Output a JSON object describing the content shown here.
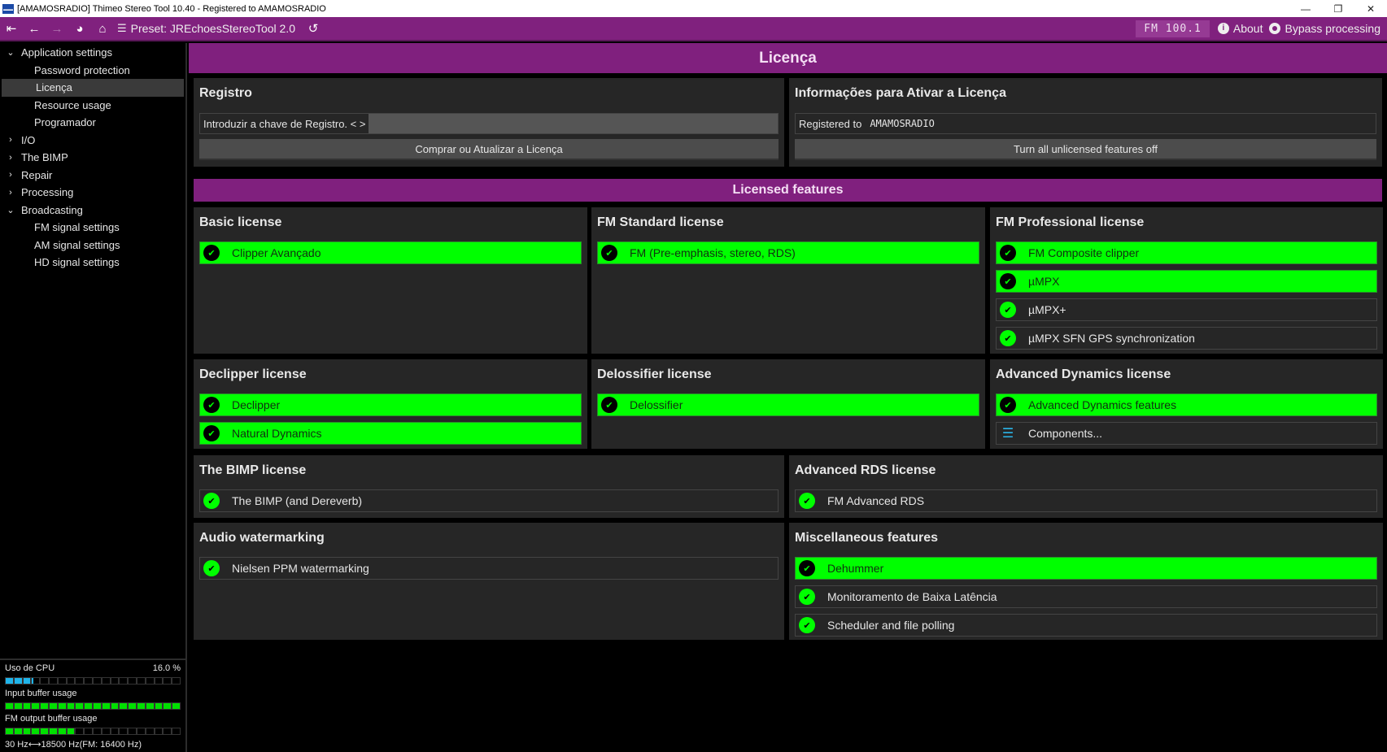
{
  "window": {
    "title": "[AMAMOSRADIO] Thimeo Stereo Tool 10.40 - Registered to AMAMOSRADIO",
    "minimize": "—",
    "restore": "❐",
    "close": "✕"
  },
  "toolbar": {
    "first_icon": "⇤",
    "back_icon": "←",
    "forward_icon": "→",
    "dashboard_icon": "◕",
    "home_icon": "⌂",
    "preset_icon": "☰",
    "preset_label": "Preset: JREchoesStereoTool 2.0",
    "undo_icon": "↺",
    "fm_display": "FM 100.1",
    "about_label": "About",
    "about_icon": "i",
    "bypass_label": "Bypass processing"
  },
  "sidebar": {
    "items": [
      {
        "label": "Application settings",
        "chevron": "⌄",
        "level": 0
      },
      {
        "label": "Password protection",
        "level": 1
      },
      {
        "label": "Licença",
        "level": 1,
        "selected": true
      },
      {
        "label": "Resource usage",
        "level": 1
      },
      {
        "label": "Programador",
        "level": 1
      },
      {
        "label": "I/O",
        "chevron": "›",
        "level": 0
      },
      {
        "label": "The BIMP",
        "chevron": "›",
        "level": 0
      },
      {
        "label": "Repair",
        "chevron": "›",
        "level": 0
      },
      {
        "label": "Processing",
        "chevron": "›",
        "level": 0
      },
      {
        "label": "Broadcasting",
        "chevron": "⌄",
        "level": 0
      },
      {
        "label": "FM signal settings",
        "level": 1
      },
      {
        "label": "AM signal settings",
        "level": 1
      },
      {
        "label": "HD signal settings",
        "level": 1
      }
    ],
    "meters": {
      "cpu_label": "Uso de CPU",
      "cpu_value": "16.0 %",
      "cpu_fraction": 0.16,
      "cpu_color": "#1fb4ea",
      "input_label": "Input buffer usage",
      "input_fraction": 1.0,
      "output_label": "FM output buffer usage",
      "output_fraction": 0.4,
      "buffer_color": "#00e000",
      "freq_low": "30 Hz",
      "freq_arrow": "⟷",
      "freq_high": "18500 Hz(FM: 16400 Hz)"
    }
  },
  "main": {
    "page_title": "Licença",
    "registro": {
      "title": "Registro",
      "key_label": "Introduzir a chave de Registro. < >",
      "key_value": "",
      "buy_button": "Comprar ou Atualizar a Licença"
    },
    "info": {
      "title": "Informações para Ativar a Licença",
      "registered_label": "Registered to",
      "registered_value": "AMAMOSRADIO",
      "turn_off_button": "Turn all unlicensed features off"
    },
    "licensed_features_title": "Licensed features",
    "panels": {
      "basic": {
        "title": "Basic license",
        "features": [
          {
            "label": "Clipper Avançado",
            "active": true
          }
        ]
      },
      "fm_standard": {
        "title": "FM Standard license",
        "features": [
          {
            "label": "FM (Pre-emphasis, stereo, RDS)",
            "active": true
          }
        ]
      },
      "fm_professional": {
        "title": "FM Professional license",
        "features": [
          {
            "label": "FM Composite clipper",
            "active": true
          },
          {
            "label": "µMPX",
            "active": true
          },
          {
            "label": "µMPX+",
            "active": false
          },
          {
            "label": "µMPX SFN GPS synchronization",
            "active": false
          }
        ]
      },
      "declipper": {
        "title": "Declipper license",
        "features": [
          {
            "label": "Declipper",
            "active": true
          },
          {
            "label": "Natural Dynamics",
            "active": true
          }
        ]
      },
      "delossifier": {
        "title": "Delossifier license",
        "features": [
          {
            "label": "Delossifier",
            "active": true
          }
        ]
      },
      "advanced_dynamics": {
        "title": "Advanced Dynamics license",
        "features": [
          {
            "label": "Advanced Dynamics features",
            "active": true
          }
        ],
        "components_label": "Components..."
      },
      "bimp": {
        "title": "The BIMP license",
        "features": [
          {
            "label": "The BIMP (and Dereverb)",
            "active": false
          }
        ]
      },
      "advanced_rds": {
        "title": "Advanced RDS license",
        "features": [
          {
            "label": "FM Advanced RDS",
            "active": false
          }
        ]
      },
      "audio_watermarking": {
        "title": "Audio watermarking",
        "features": [
          {
            "label": "Nielsen PPM watermarking",
            "active": false
          }
        ]
      },
      "misc": {
        "title": "Miscellaneous features",
        "features": [
          {
            "label": "Dehummer",
            "active": true
          },
          {
            "label": "Monitoramento de Baixa Latência",
            "active": false
          },
          {
            "label": "Scheduler and file polling",
            "active": false
          }
        ]
      }
    },
    "check_icon": "✔",
    "components_icon": "☰"
  },
  "colors": {
    "accent": "#80207e",
    "active_feature": "#00ff00",
    "panel_bg": "#262626"
  }
}
